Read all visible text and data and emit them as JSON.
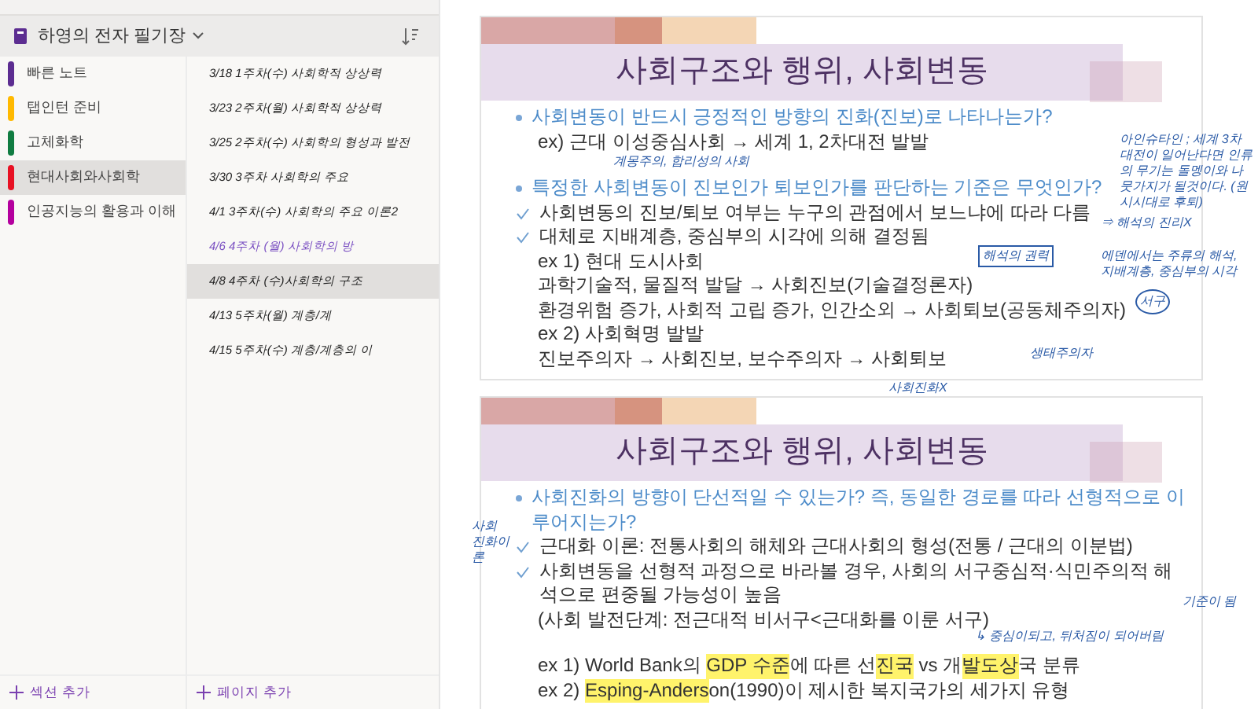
{
  "notebook": {
    "title": "하영의 전자 필기장"
  },
  "sections": [
    {
      "label": "빠른 노트",
      "color": "#5c2d91",
      "selected": false
    },
    {
      "label": "탭인턴 준비",
      "color": "#ffb900",
      "selected": false
    },
    {
      "label": "고체화학",
      "color": "#107c41",
      "selected": false
    },
    {
      "label": "현대사회와사회학",
      "color": "#e81123",
      "selected": true
    },
    {
      "label": "인공지능의 활용과 이해",
      "color": "#b4009e",
      "selected": false
    }
  ],
  "pages": [
    {
      "title": "3/18 1주차(수) 사회학적 상상력",
      "color": "#222222",
      "selected": false
    },
    {
      "title": "3/23 2주차(월) 사회학적 상상력",
      "color": "#222222",
      "selected": false
    },
    {
      "title": "3/25 2주차(수) 사회학의 형성과 발전",
      "color": "#222222",
      "selected": false
    },
    {
      "title": "3/30 3주차 사회학의 주요",
      "color": "#222222",
      "selected": false
    },
    {
      "title": "4/1 3주차(수) 사회학의 주요 이론2",
      "color": "#222222",
      "selected": false
    },
    {
      "title": "4/6 4주차 (월) 사회학의 방",
      "color": "#7a4fc2",
      "selected": false
    },
    {
      "title": "4/8 4주차 (수)사회학의 구조",
      "color": "#222222",
      "selected": true
    },
    {
      "title": "4/13 5주차(월) 계층/계",
      "color": "#222222",
      "selected": false
    },
    {
      "title": "4/15 5주차(수) 계층/계층의 이",
      "color": "#222222",
      "selected": false
    }
  ],
  "add_section": "섹션 추가",
  "add_page": "페이지 추가",
  "slides": [
    {
      "title": "사회구조와 행위, 사회변동",
      "lines": [
        {
          "kind": "bullet",
          "text": "사회변동이 반드시 긍정적인 방향의 진화(진보)로 나타나는가?"
        },
        {
          "kind": "plain",
          "text": "ex) 근대 이성중심사회 → 세계 1, 2차대전 발발"
        },
        {
          "kind": "gap"
        },
        {
          "kind": "bullet",
          "text": "특정한 사회변동이 진보인가 퇴보인가를 판단하는 기준은 무엇인가?"
        },
        {
          "kind": "check",
          "text": "사회변동의 진보/퇴보 여부는 누구의 관점에서 보느냐에 따라 다름"
        },
        {
          "kind": "check",
          "text": "대체로 지배계층, 중심부의 시각에 의해 결정됨"
        },
        {
          "kind": "plain",
          "text": "ex 1) 현대 도시사회"
        },
        {
          "kind": "plain",
          "text": "과학기술적, 물질적 발달 → 사회진보(기술결정론자)"
        },
        {
          "kind": "plain",
          "text": "환경위험 증가, 사회적 고립 증가, 인간소외 → 사회퇴보(공동체주의자)"
        },
        {
          "kind": "plain",
          "text": "ex 2) 사회혁명 발발"
        },
        {
          "kind": "plain",
          "text": "진보주의자 → 사회진보, 보수주의자 → 사회퇴보"
        }
      ]
    },
    {
      "title": "사회구조와 행위, 사회변동",
      "lines": [
        {
          "kind": "bullet",
          "text": "사회진화의 방향이 단선적일 수 있는가? 즉, 동일한 경로를 따라 선형적으로 이루어지는가?"
        },
        {
          "kind": "check",
          "text": "근대화 이론: 전통사회의 해체와 근대사회의 형성(전통 / 근대의 이분법)"
        },
        {
          "kind": "check",
          "text": "사회변동을 선형적 과정으로 바라볼 경우, 사회의 서구중심적·식민주의적 해석으로 편중될 가능성이 높음"
        },
        {
          "kind": "plain",
          "text": "(사회 발전단계: 전근대적 비서구<근대화를 이룬 서구)"
        },
        {
          "kind": "gap"
        },
        {
          "kind": "marked",
          "segments": [
            {
              "text": "ex 1) World Bank의 ",
              "highlight": false
            },
            {
              "text": "GDP 수준",
              "highlight": true
            },
            {
              "text": "에 따른 선",
              "highlight": false
            },
            {
              "text": "진국",
              "highlight": true
            },
            {
              "text": " vs 개",
              "highlight": false
            },
            {
              "text": "발도상",
              "highlight": true
            },
            {
              "text": "국 분류",
              "highlight": false
            }
          ]
        },
        {
          "kind": "marked",
          "segments": [
            {
              "text": "ex 2) ",
              "highlight": false
            },
            {
              "text": "Esping-Anders",
              "highlight": true
            },
            {
              "text": "on(1990)이 제시한 복지국가의 세가지 유형",
              "highlight": false
            }
          ]
        }
      ]
    }
  ],
  "annotations": [
    "계몽주의, 합리성의 사회",
    "아인슈타인 ; 세계 3차 대전이 일어난다면 인류의 무기는 돌멩이와 나뭇가지가 될것이다. (원시시대로 후퇴)",
    "⇒ 해석의 진리X",
    "해석의 권력",
    "에덴에서는 주류의 해석, 지배계층, 중심부의 시각",
    "서구",
    "생태주의자",
    "사회진화X",
    "사회 진화이론",
    "기준이 됨",
    "↳ 중심이되고, 뒤처짐이 되어버림"
  ]
}
